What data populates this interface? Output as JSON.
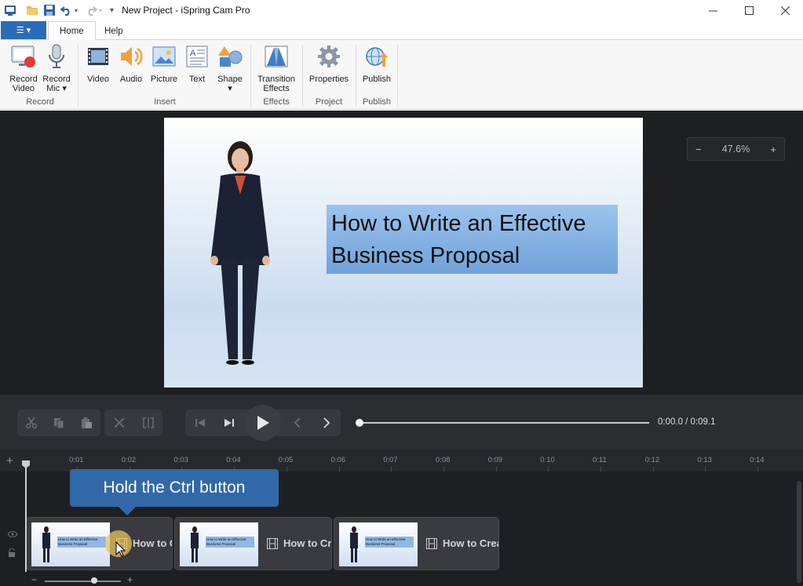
{
  "window": {
    "title": "New Project - iSpring Cam Pro",
    "controls": [
      "minimize",
      "maximize",
      "close"
    ]
  },
  "quick_access": [
    "app-icon",
    "open-folder-icon",
    "save-icon",
    "undo-icon",
    "redo-icon",
    "customize-icon"
  ],
  "tabs": {
    "file_menu": "☰ ▾",
    "items": [
      {
        "label": "Home",
        "active": true
      },
      {
        "label": "Help",
        "active": false
      }
    ]
  },
  "ribbon": {
    "groups": [
      {
        "label": "Record",
        "buttons": [
          {
            "label": "Record\nVideo",
            "icon": "record-video-icon"
          },
          {
            "label": "Record\nMic ▾",
            "icon": "microphone-icon"
          }
        ]
      },
      {
        "label": "Insert",
        "buttons": [
          {
            "label": "Video",
            "icon": "film-icon"
          },
          {
            "label": "Audio",
            "icon": "speaker-icon"
          },
          {
            "label": "Picture",
            "icon": "picture-icon"
          },
          {
            "label": "Text",
            "icon": "text-icon"
          },
          {
            "label": "Shape\n▾",
            "icon": "shape-icon"
          }
        ]
      },
      {
        "label": "Effects",
        "buttons": [
          {
            "label": "Transition\nEffects",
            "icon": "transition-icon"
          }
        ]
      },
      {
        "label": "Project",
        "buttons": [
          {
            "label": "Properties",
            "icon": "gear-icon"
          }
        ]
      },
      {
        "label": "Publish",
        "buttons": [
          {
            "label": "Publish",
            "icon": "globe-upload-icon"
          }
        ]
      }
    ]
  },
  "preview": {
    "slide_title": "How to Write an Effective Business Proposal",
    "zoom": {
      "minus": "−",
      "value": "47.6%",
      "plus": "+"
    }
  },
  "player": {
    "time": "0:00.0 / 0:09.1",
    "progress": 0.0
  },
  "timeline": {
    "ticks": [
      "0:01",
      "0:02",
      "0:03",
      "0:04",
      "0:05",
      "0:06",
      "0:07",
      "0:08",
      "0:09",
      "0:10",
      "0:11",
      "0:12",
      "0:13",
      "0:14"
    ],
    "tooltip": "Hold the Ctrl button",
    "clips": [
      {
        "label": "How to C",
        "thumb_text": "How to Write an Effective Business Proposal"
      },
      {
        "label": "How to Cre",
        "thumb_text": "How to Write an Effective Business Proposal"
      },
      {
        "label": "How to Creat",
        "thumb_text": "How to Write an Effective Business Proposal"
      }
    ],
    "zoom_minus": "−",
    "zoom_plus": "+"
  },
  "colors": {
    "accent": "#2a6cb8",
    "tooltip": "#3169a8",
    "dark_bg": "#1e1f22"
  }
}
